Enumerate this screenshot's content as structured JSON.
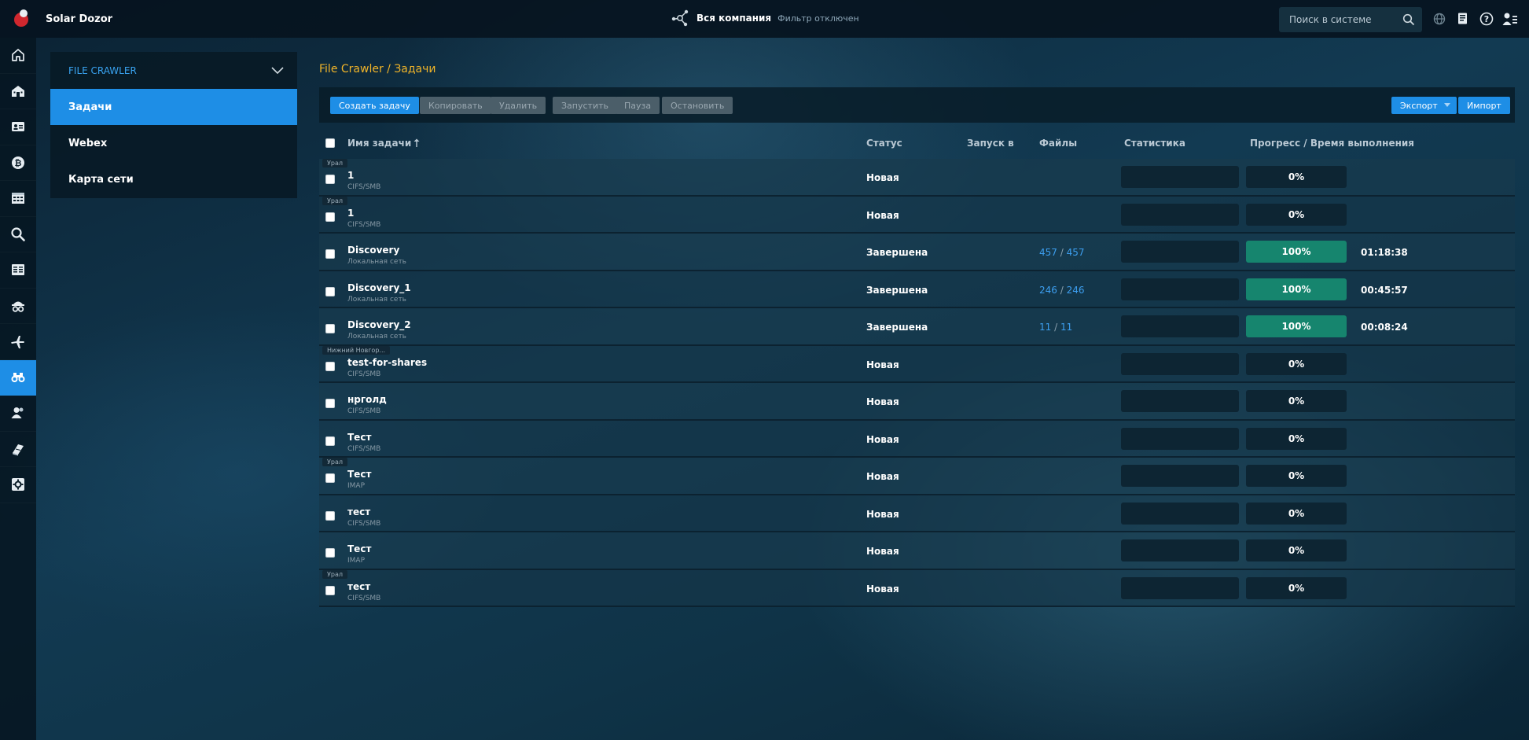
{
  "app": {
    "name": "Solar Dozor"
  },
  "topbar": {
    "company": "Вся компания",
    "filter": "Фильтр отключен",
    "search_placeholder": "Поиск в системе",
    "icons": [
      "globe-icon",
      "document-icon",
      "help-icon",
      "user-menu-icon"
    ]
  },
  "rail": {
    "items": [
      {
        "icon": "home-icon"
      },
      {
        "icon": "building-icon"
      },
      {
        "icon": "id-card-icon"
      },
      {
        "icon": "bitcoin-icon"
      },
      {
        "icon": "calendar-table-icon"
      },
      {
        "icon": "search-icon"
      },
      {
        "icon": "news-icon"
      },
      {
        "icon": "spy-icon"
      },
      {
        "icon": "airplane-icon"
      },
      {
        "icon": "binoculars-icon",
        "active": true
      },
      {
        "icon": "users-icon"
      },
      {
        "icon": "books-icon"
      },
      {
        "icon": "settings-icon"
      }
    ]
  },
  "submenu": {
    "title": "FILE CRAWLER",
    "items": [
      {
        "label": "Задачи",
        "active": true
      },
      {
        "label": "Webex"
      },
      {
        "label": "Карта сети"
      }
    ]
  },
  "breadcrumb": "File Crawler / Задачи",
  "toolbar": {
    "create": "Создать задачу",
    "copy": "Копировать",
    "delete": "Удалить",
    "start": "Запустить",
    "pause": "Пауза",
    "stop": "Остановить",
    "export": "Экспорт",
    "import": "Импорт"
  },
  "table": {
    "columns": {
      "name": "Имя задачи",
      "status": "Статус",
      "launch": "Запуск в",
      "files": "Файлы",
      "stats": "Статистика",
      "progress": "Прогресс / Время выполнения"
    },
    "rows": [
      {
        "region": "Урал",
        "name": "1",
        "proto": "CIFS/SMB",
        "status": "Новая",
        "files_a": "",
        "files_b": "",
        "progress": "0%",
        "progress_value": 0,
        "time": ""
      },
      {
        "region": "Урал",
        "name": "1",
        "proto": "CIFS/SMB",
        "status": "Новая",
        "files_a": "",
        "files_b": "",
        "progress": "0%",
        "progress_value": 0,
        "time": ""
      },
      {
        "region": "",
        "name": "Discovery",
        "proto": "Локальная сеть",
        "status": "Завершена",
        "files_a": "457",
        "files_b": "457",
        "progress": "100%",
        "progress_value": 100,
        "time": "01:18:38"
      },
      {
        "region": "",
        "name": "Discovery_1",
        "proto": "Локальная сеть",
        "status": "Завершена",
        "files_a": "246",
        "files_b": "246",
        "progress": "100%",
        "progress_value": 100,
        "time": "00:45:57"
      },
      {
        "region": "",
        "name": "Discovery_2",
        "proto": "Локальная сеть",
        "status": "Завершена",
        "files_a": "11",
        "files_b": "11",
        "progress": "100%",
        "progress_value": 100,
        "time": "00:08:24"
      },
      {
        "region": "Нижний Новгор...",
        "name": "test-for-shares",
        "proto": "CIFS/SMB",
        "status": "Новая",
        "files_a": "",
        "files_b": "",
        "progress": "0%",
        "progress_value": 0,
        "time": ""
      },
      {
        "region": "",
        "name": "нрголд",
        "proto": "CIFS/SMB",
        "status": "Новая",
        "files_a": "",
        "files_b": "",
        "progress": "0%",
        "progress_value": 0,
        "time": ""
      },
      {
        "region": "",
        "name": "Тест",
        "proto": "CIFS/SMB",
        "status": "Новая",
        "files_a": "",
        "files_b": "",
        "progress": "0%",
        "progress_value": 0,
        "time": ""
      },
      {
        "region": "Урал",
        "name": "Тест",
        "proto": "IMAP",
        "status": "Новая",
        "files_a": "",
        "files_b": "",
        "progress": "0%",
        "progress_value": 0,
        "time": ""
      },
      {
        "region": "",
        "name": "тест",
        "proto": "CIFS/SMB",
        "status": "Новая",
        "files_a": "",
        "files_b": "",
        "progress": "0%",
        "progress_value": 0,
        "time": ""
      },
      {
        "region": "",
        "name": "Тест",
        "proto": "IMAP",
        "status": "Новая",
        "files_a": "",
        "files_b": "",
        "progress": "0%",
        "progress_value": 0,
        "time": ""
      },
      {
        "region": "Урал",
        "name": "тест",
        "proto": "CIFS/SMB",
        "status": "Новая",
        "files_a": "",
        "files_b": "",
        "progress": "0%",
        "progress_value": 0,
        "time": ""
      }
    ]
  },
  "colors": {
    "accent": "#1e8ee6",
    "breadcrumb": "#f0b429",
    "progress_fill": "#16856e",
    "link": "#3d9ff0"
  }
}
